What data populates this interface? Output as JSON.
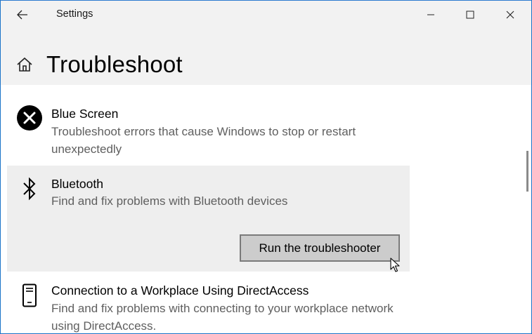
{
  "window": {
    "title": "Settings"
  },
  "icons": {
    "back": "back-arrow-icon",
    "minimize": "minimize-icon",
    "maximize": "maximize-icon",
    "close": "close-icon",
    "home": "home-icon"
  },
  "page": {
    "title": "Troubleshoot"
  },
  "items": [
    {
      "title": "Blue Screen",
      "description": "Troubleshoot errors that cause Windows to stop or restart unexpectedly",
      "icon": "error-x-circle-icon"
    },
    {
      "title": "Bluetooth",
      "description": "Find and fix problems with Bluetooth devices",
      "icon": "bluetooth-icon",
      "selected": true,
      "button_label": "Run the troubleshooter"
    },
    {
      "title": "Connection to a Workplace Using DirectAccess",
      "description": "Find and fix problems with connecting to your workplace network using DirectAccess.",
      "icon": "phone-device-icon"
    }
  ],
  "colors": {
    "header_bg": "#f2f2f2",
    "selected_item_bg": "#eeeeee",
    "button_bg": "#cccccc",
    "button_border": "#7a7a7a",
    "window_border": "#1a73c8"
  }
}
